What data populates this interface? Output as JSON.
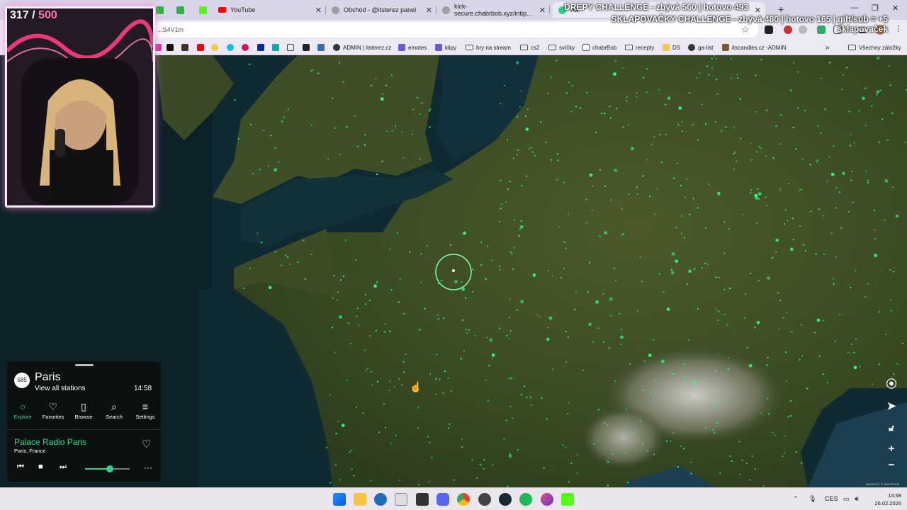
{
  "browser": {
    "tabs": [
      {
        "label": "YouTube",
        "favicon_color": "#ff0000"
      },
      {
        "label": "Obchod - @itsterez panel",
        "favicon_color": "#9aa0a6"
      },
      {
        "label": "kick-secure.chabrbob.xyz/intip...",
        "favicon_color": "#9aa0a6"
      },
      {
        "label": "Ra",
        "favicon_color": "#2fd28a"
      }
    ],
    "url": "...S4V1m",
    "bookmarks": [
      "ADMIN | itsterez.cz",
      "emotes",
      "klipy",
      "hry na stream",
      "cs2",
      "svíčky",
      "chabrBob",
      "recepty",
      "DS",
      "ga-list",
      "itscandles.cz -ADMIN"
    ],
    "all_bookmarks": "Všechny záložky"
  },
  "overlay": {
    "counter_current": "317",
    "counter_sep": " / ",
    "counter_goal": "500",
    "ticker_line1": "DREPY CHALLENGE - zbývá 560 | hotovo 493",
    "ticker_line2": "SKLAPOVAČKY CHALLENGE - zbývá 480 | hotovo 165 | gift/sub = +5 sklapovaček"
  },
  "player": {
    "station_count": "585",
    "city": "Paris",
    "view_all": "View all stations",
    "local_time": "14:58",
    "nav": [
      {
        "label": "Explore",
        "icon": "explore-icon"
      },
      {
        "label": "Favorites",
        "icon": "heart-icon"
      },
      {
        "label": "Browse",
        "icon": "map-icon"
      },
      {
        "label": "Search",
        "icon": "search-icon"
      },
      {
        "label": "Settings",
        "icon": "menu-icon"
      }
    ],
    "station": "Palace Radio Paris",
    "location": "Paris, France",
    "volume": 0.55
  },
  "map": {
    "attribution": "IMAGERY © MAPTILER",
    "dot_color": "#2dff7a"
  },
  "taskbar": {
    "language": "CES",
    "time": "14:58",
    "date": "26.02.2026"
  }
}
